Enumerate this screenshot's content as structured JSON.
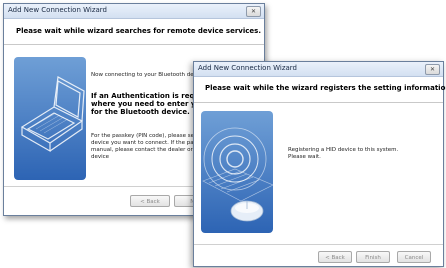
{
  "window_back": {
    "title": "Add New Connection Wizard",
    "close_glyph": "✕",
    "header": "Please wait while wizard searches for remote device services.",
    "status_text": "Now connecting to your Bluetooth device",
    "auth_line1": "If an Authentication is required, a",
    "auth_line2": "where you need to enter your Pa",
    "auth_line3": "for the Bluetooth device.",
    "passkey_line1": "For the passkey (PIN code), please see",
    "passkey_line2": "device you want to connect. If the pass",
    "passkey_line3": "manual, please contact the dealer or the",
    "passkey_line4": "device",
    "back_label": "< Back",
    "next_label": "Ne"
  },
  "window_front": {
    "title": "Add New Connection Wizard",
    "close_glyph": "✕",
    "header": "Please wait while the wizard registers the setting information.",
    "status_line1": "Registering a HID device to this system.",
    "status_line2": "Please wait.",
    "back_label": "< Back",
    "finish_label": "Finish",
    "cancel_label": "Cancel"
  },
  "icons": [
    "laptop-bluetooth-art",
    "mouse-signal-art",
    "close-icon"
  ]
}
